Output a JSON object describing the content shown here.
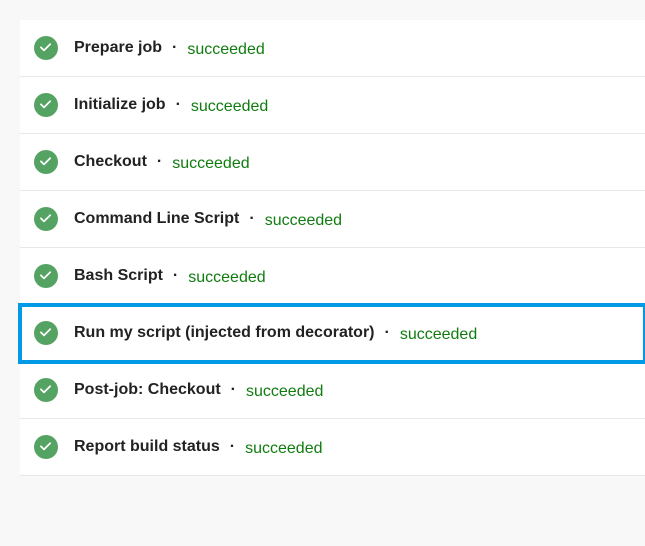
{
  "separator": "·",
  "steps": [
    {
      "name": "Prepare job",
      "status": "succeeded",
      "highlighted": false
    },
    {
      "name": "Initialize job",
      "status": "succeeded",
      "highlighted": false
    },
    {
      "name": "Checkout",
      "status": "succeeded",
      "highlighted": false
    },
    {
      "name": "Command Line Script",
      "status": "succeeded",
      "highlighted": false
    },
    {
      "name": "Bash Script",
      "status": "succeeded",
      "highlighted": false
    },
    {
      "name": "Run my script (injected from decorator)",
      "status": "succeeded",
      "highlighted": true
    },
    {
      "name": "Post-job: Checkout",
      "status": "succeeded",
      "highlighted": false
    },
    {
      "name": "Report build status",
      "status": "succeeded",
      "highlighted": false
    }
  ]
}
